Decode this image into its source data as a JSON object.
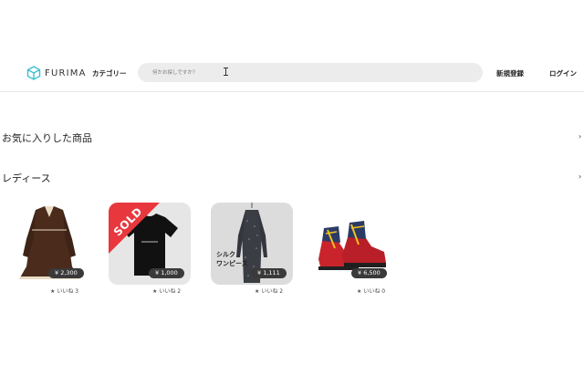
{
  "header": {
    "logo_text": "FURIMA",
    "category_label": "カテゴリー",
    "search_placeholder": "何かお探しですか？",
    "signup_label": "新規登録",
    "login_label": "ログイン"
  },
  "sections": [
    {
      "title": "お気に入りした商品",
      "arrow": "›"
    },
    {
      "title": "レディース",
      "arrow": "›"
    }
  ],
  "items": [
    {
      "price": "¥ 2,300",
      "likes": "いいね 3",
      "sold": false,
      "image": "brown-dress"
    },
    {
      "price": "¥ 1,000",
      "likes": "いいね 2",
      "sold": true,
      "sold_label": "SOLD",
      "image": "black-tshirt"
    },
    {
      "price": "¥ 1,111",
      "likes": "いいね 2",
      "sold": false,
      "image": "silk-dress",
      "image_text": [
        "シルク",
        "ワンピース"
      ]
    },
    {
      "price": "¥ 6,500",
      "likes": "いいね 0",
      "sold": false,
      "image": "hiking-boots"
    }
  ],
  "colors": {
    "accent": "#3bbfd0",
    "sold": "#e8383d",
    "price_badge": "#3a3a3a",
    "search_bg": "#ececec"
  }
}
